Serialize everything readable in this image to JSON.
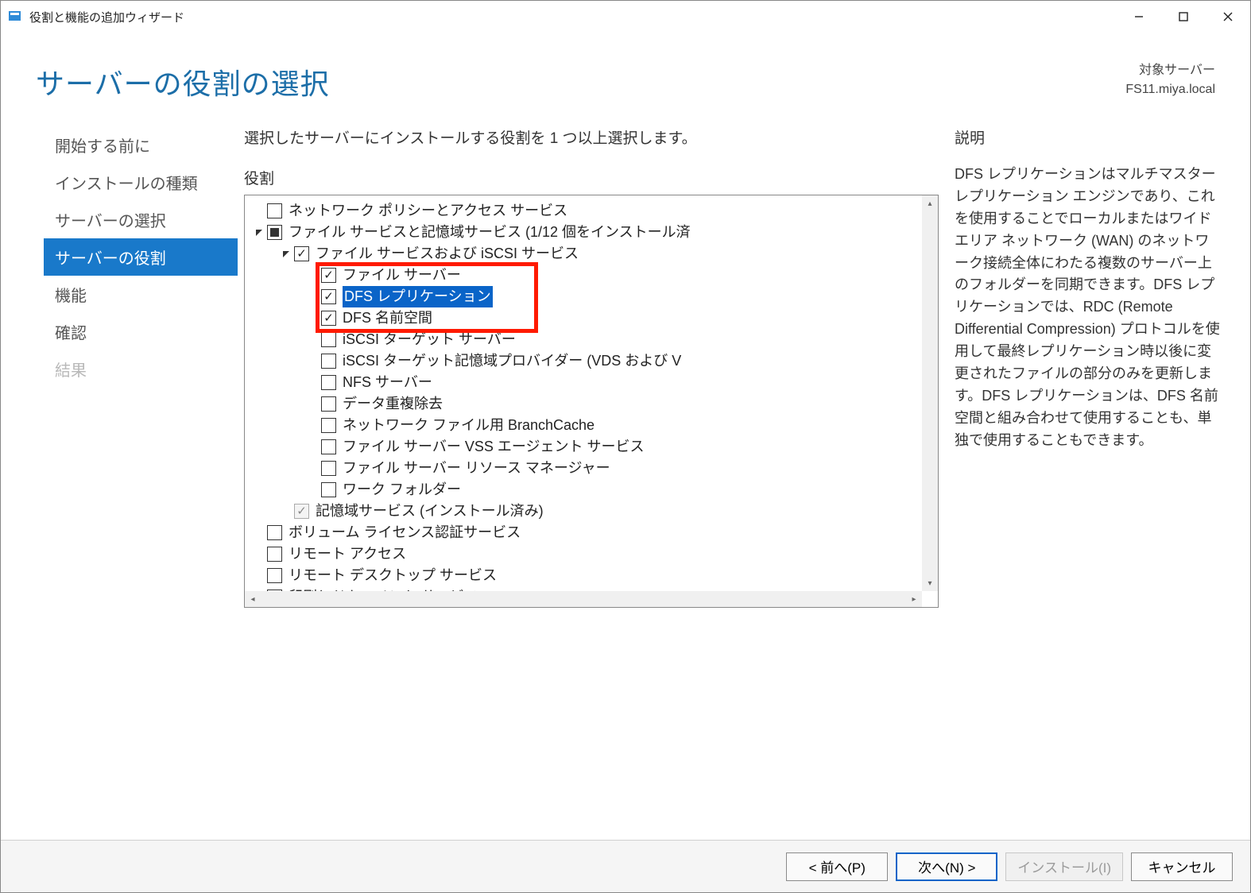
{
  "window": {
    "title": "役割と機能の追加ウィザード"
  },
  "header": {
    "page_title": "サーバーの役割の選択",
    "target_label": "対象サーバー",
    "target_name": "FS11.miya.local"
  },
  "sidebar": {
    "items": [
      {
        "label": "開始する前に"
      },
      {
        "label": "インストールの種類"
      },
      {
        "label": "サーバーの選択"
      },
      {
        "label": "サーバーの役割",
        "active": true
      },
      {
        "label": "機能"
      },
      {
        "label": "確認"
      },
      {
        "label": "結果",
        "disabled": true
      }
    ]
  },
  "main": {
    "instruction": "選択したサーバーにインストールする役割を 1 つ以上選択します。",
    "roles_label": "役割",
    "tree": [
      {
        "indent": 0,
        "state": "unchecked",
        "label": "ネットワーク ポリシーとアクセス サービス"
      },
      {
        "indent": 0,
        "state": "mixed",
        "label": "ファイル サービスと記憶域サービス (1/12 個をインストール済",
        "expander": "open"
      },
      {
        "indent": 1,
        "state": "checked",
        "label": "ファイル サービスおよび iSCSI サービス",
        "expander": "open"
      },
      {
        "indent": 2,
        "state": "checked",
        "label": "ファイル サーバー",
        "highlight_group": true
      },
      {
        "indent": 2,
        "state": "checked",
        "label": "DFS レプリケーション",
        "selected": true,
        "highlight_group": true
      },
      {
        "indent": 2,
        "state": "checked",
        "label": "DFS 名前空間",
        "highlight_group": true
      },
      {
        "indent": 2,
        "state": "unchecked",
        "label": "iSCSI ターゲット サーバー"
      },
      {
        "indent": 2,
        "state": "unchecked",
        "label": "iSCSI ターゲット記憶域プロバイダー (VDS および V"
      },
      {
        "indent": 2,
        "state": "unchecked",
        "label": "NFS サーバー"
      },
      {
        "indent": 2,
        "state": "unchecked",
        "label": "データ重複除去"
      },
      {
        "indent": 2,
        "state": "unchecked",
        "label": "ネットワーク ファイル用 BranchCache"
      },
      {
        "indent": 2,
        "state": "unchecked",
        "label": "ファイル サーバー VSS エージェント サービス"
      },
      {
        "indent": 2,
        "state": "unchecked",
        "label": "ファイル サーバー リソース マネージャー"
      },
      {
        "indent": 2,
        "state": "unchecked",
        "label": "ワーク フォルダー"
      },
      {
        "indent": 1,
        "state": "checked",
        "label": "記憶域サービス (インストール済み)",
        "disabled": true
      },
      {
        "indent": 0,
        "state": "unchecked",
        "label": "ボリューム ライセンス認証サービス"
      },
      {
        "indent": 0,
        "state": "unchecked",
        "label": "リモート アクセス"
      },
      {
        "indent": 0,
        "state": "unchecked",
        "label": "リモート デスクトップ サービス"
      },
      {
        "indent": 0,
        "state": "unchecked",
        "label": "印刷とドキュメント サービス"
      }
    ]
  },
  "right": {
    "desc_label": "説明",
    "desc_text": "DFS レプリケーションはマルチマスター レプリケーション エンジンであり、これを使用することでローカルまたはワイド エリア ネットワーク (WAN) のネットワーク接続全体にわたる複数のサーバー上のフォルダーを同期できます。DFS レプリケーションでは、RDC (Remote Differential Compression) プロトコルを使用して最終レプリケーション時以後に変更されたファイルの部分のみを更新します。DFS レプリケーションは、DFS 名前空間と組み合わせて使用することも、単独で使用することもできます。"
  },
  "buttons": {
    "prev": "< 前へ(P)",
    "next": "次へ(N) >",
    "install": "インストール(I)",
    "cancel": "キャンセル"
  }
}
